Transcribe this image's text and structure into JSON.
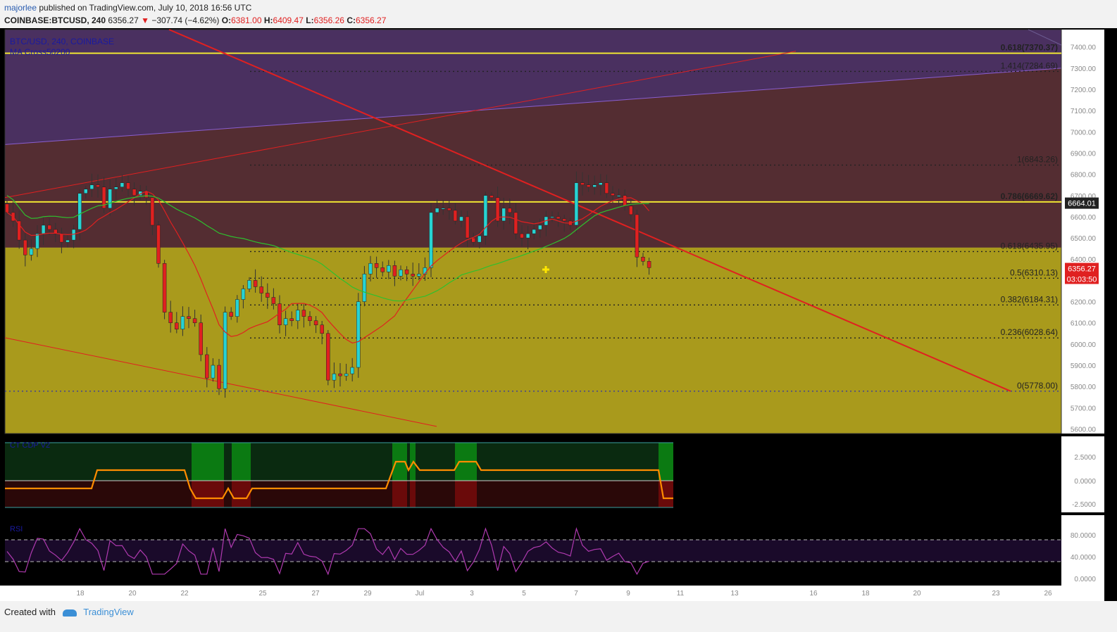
{
  "header": {
    "author": "majorlee",
    "published": "published on TradingView.com, July 10, 2018 16:56 UTC",
    "symbol": "COINBASE:BTCUSD, 240",
    "last": "6356.27",
    "change": "−307.74 (−4.62%)",
    "o_label": "O:",
    "o": "6381.00",
    "h_label": "H:",
    "h": "6409.47",
    "l_label": "L:",
    "l": "6356.26",
    "c_label": "C:",
    "c": "6356.27"
  },
  "footer": {
    "created_with": "Created with",
    "brand": "TradingView"
  },
  "colors": {
    "up": "#27d3d3",
    "down": "#e02020",
    "fib_main": "#f0e632",
    "upper_zone": "#4a3060",
    "lower_zone": "#a99a1c",
    "ma_fast": "#e02020",
    "ma_slow": "#2ec02e",
    "rsi": "#b03ab0",
    "cm_line": "#ff8c00"
  },
  "chart_data": [
    {
      "type": "candlestick",
      "legend": [
        "BTC/USD, 240, COINBASE",
        "MA Cross50200"
      ],
      "ylim": [
        5600,
        7500
      ],
      "y_ticks": [
        "7400.00",
        "7300.00",
        "7200.00",
        "7100.00",
        "7000.00",
        "6900.00",
        "6800.00",
        "6700.00",
        "6600.00",
        "6500.00",
        "6400.00",
        "6300.00",
        "6200.00",
        "6100.00",
        "6000.00",
        "5900.00",
        "5800.00",
        "5700.00",
        "5600.00"
      ],
      "x_ticks": [
        "18",
        "20",
        "22",
        "25",
        "27",
        "29",
        "Jul",
        "3",
        "5",
        "7",
        "9",
        "11",
        "13",
        "16",
        "18",
        "20",
        "23",
        "26"
      ],
      "price_labels": {
        "current": "6356.27",
        "countdown": "03:03:50",
        "marker": "6664.01"
      },
      "fib_levels_major": [
        {
          "label": "0.618(7370.37)",
          "value": 7370.37
        },
        {
          "label": "0.786(6669.62)",
          "value": 6669.62
        }
      ],
      "fib_levels_minor": [
        {
          "label": "1.414(7284.69)",
          "value": 7284.69
        },
        {
          "label": "1(6843.26)",
          "value": 6843.26
        },
        {
          "label": "0.618(6435.95)",
          "value": 6435.95
        },
        {
          "label": "0.5(6310.13)",
          "value": 6310.13
        },
        {
          "label": "0.382(6184.31)",
          "value": 6184.31
        },
        {
          "label": "0.236(6028.64)",
          "value": 6028.64
        },
        {
          "label": "0(5778.00)",
          "value": 5778.0
        }
      ],
      "closes": [
        6620,
        6580,
        6490,
        6420,
        6450,
        6520,
        6560,
        6540,
        6520,
        6480,
        6490,
        6540,
        6710,
        6730,
        6750,
        6740,
        6640,
        6730,
        6740,
        6760,
        6730,
        6700,
        6720,
        6690,
        6560,
        6380,
        6150,
        6100,
        6070,
        6130,
        6120,
        6100,
        5950,
        5840,
        5900,
        5790,
        6150,
        6130,
        6210,
        6260,
        6300,
        6270,
        6240,
        6220,
        6190,
        6090,
        6120,
        6110,
        6160,
        6130,
        6110,
        6090,
        6050,
        5830,
        5860,
        5850,
        5860,
        5890,
        6200,
        6330,
        6380,
        6360,
        6340,
        6370,
        6320,
        6350,
        6330,
        6320,
        6330,
        6360,
        6620,
        6640,
        6640,
        6630,
        6580,
        6600,
        6500,
        6480,
        6510,
        6700,
        6690,
        6580,
        6640,
        6620,
        6520,
        6500,
        6520,
        6540,
        6560,
        6600,
        6600,
        6590,
        6580,
        6560,
        6760,
        6750,
        6740,
        6750,
        6760,
        6710,
        6700,
        6700,
        6650,
        6610,
        6410,
        6390,
        6360
      ]
    },
    {
      "type": "histogram",
      "title": "CT CDP V2",
      "y_ticks": [
        "2.5000",
        "0.0000",
        "-2.5000"
      ]
    },
    {
      "type": "line",
      "title": "RSI",
      "y_ticks": [
        "80.0000",
        "40.0000",
        "0.0000"
      ]
    }
  ]
}
